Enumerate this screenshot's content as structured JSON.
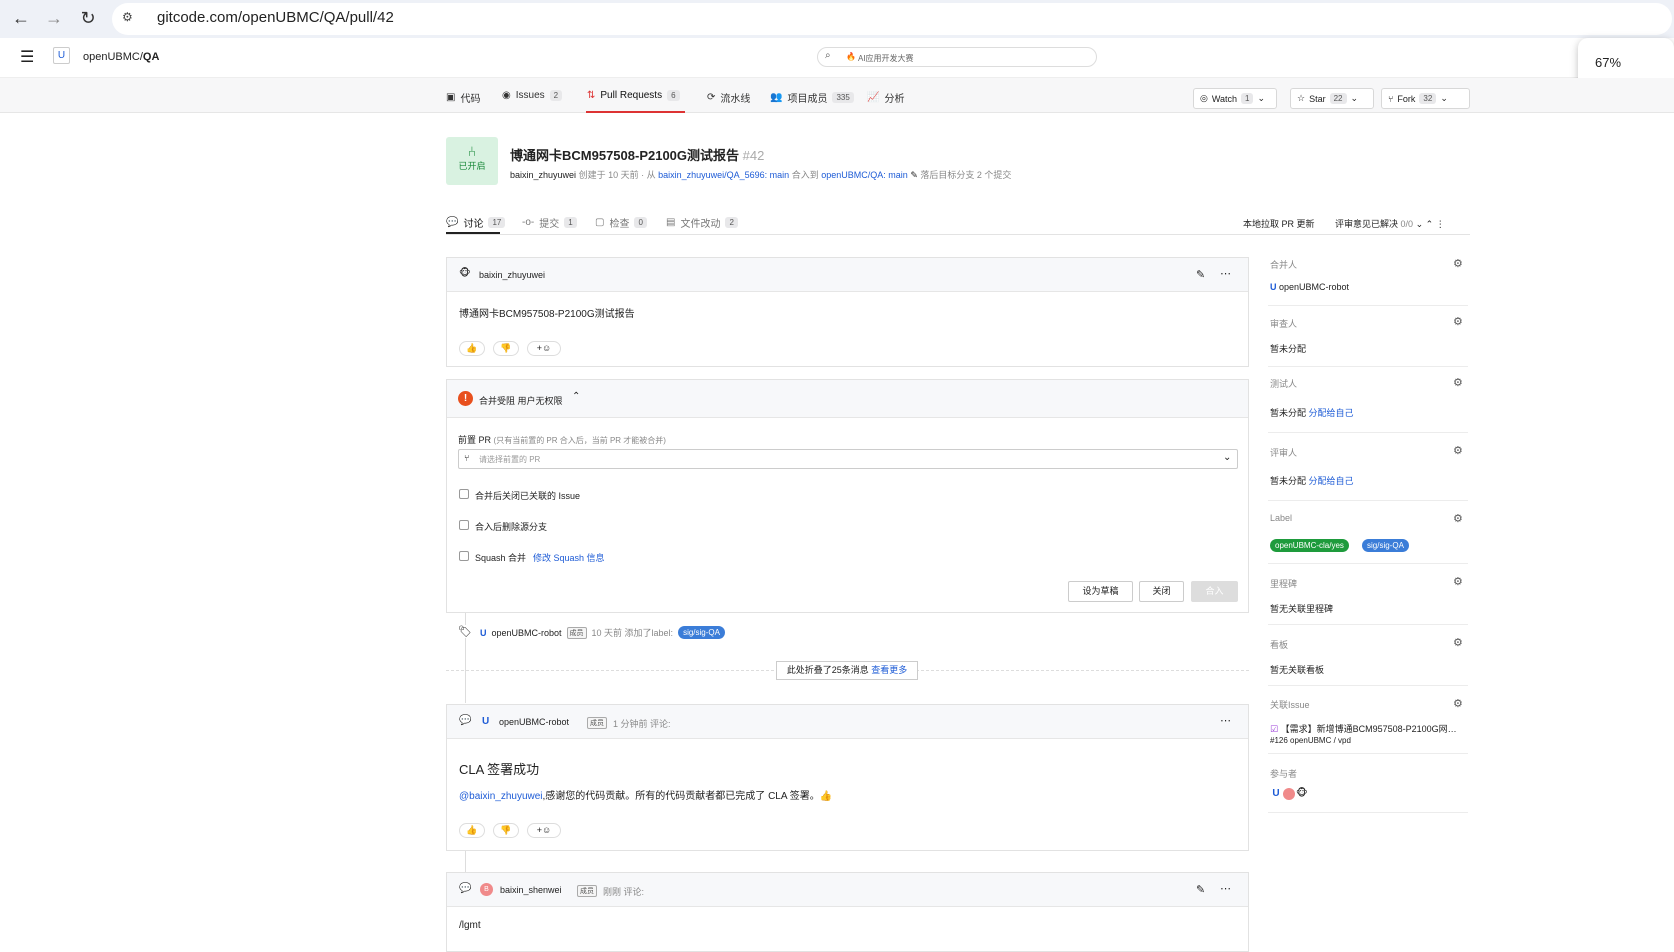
{
  "browser": {
    "url": "gitcode.com/openUBMC/QA/pull/42",
    "zoom": "67%"
  },
  "header": {
    "repo_name": "openUBMC/",
    "repo_bold": "QA",
    "search_placeholder": "AI应用开发大赛"
  },
  "repo_nav": {
    "tabs": [
      {
        "label": "代码",
        "count": ""
      },
      {
        "label": "Issues",
        "count": "2"
      },
      {
        "label": "Pull Requests",
        "count": "6"
      },
      {
        "label": "流水线",
        "count": ""
      },
      {
        "label": "项目成员",
        "count": "335"
      },
      {
        "label": "分析",
        "count": ""
      }
    ],
    "watch": {
      "label": "Watch",
      "count": "1"
    },
    "star": {
      "label": "Star",
      "count": "22"
    },
    "fork": {
      "label": "Fork",
      "count": "32"
    }
  },
  "pr": {
    "status": "已开启",
    "title": "博通网卡BCM957508-P2100G测试报告",
    "number": "#42",
    "author": "baixin_zhuyuwei",
    "created": "创建于 10 天前",
    "from_word": "· 从",
    "source_branch": "baixin_zhuyuwei/QA_5696: main",
    "merge_into": "合入到",
    "target_branch": "openUBMC/QA: main",
    "behind": "落后目标分支 2 个提交"
  },
  "pr_tabs": [
    {
      "label": "讨论",
      "count": "17"
    },
    {
      "label": "提交",
      "count": "1"
    },
    {
      "label": "检查",
      "count": "0"
    },
    {
      "label": "文件改动",
      "count": "2"
    }
  ],
  "pr_tools": {
    "fetch": "本地拉取 PR 更新",
    "resolved": "评审意见已解决",
    "resolved_count": "0/0"
  },
  "description": {
    "author": "baixin_zhuyuwei",
    "body": "博通网卡BCM957508-P2100G测试报告",
    "reaction_up": "👍",
    "reaction_down": "👎",
    "reaction_add": "+☺"
  },
  "merge_box": {
    "status": "合并受阻 用户无权限",
    "pre_pr_label": "前置 PR",
    "pre_pr_hint": "(只有当前置的 PR 合入后，当前 PR 才能被合并)",
    "pre_pr_placeholder": "请选择前置的 PR",
    "opt_close_issue": "合并后关闭已关联的 Issue",
    "opt_delete_branch": "合入后删除源分支",
    "opt_squash": "Squash 合并",
    "squash_link": "修改 Squash 信息",
    "btn_draft": "设为草稿",
    "btn_close": "关闭",
    "btn_merge": "合入"
  },
  "timeline": {
    "label_event": {
      "user": "openUBMC-robot",
      "role": "成员",
      "text": "10 天前 添加了label:",
      "label": "sig/sig-QA"
    },
    "folded": {
      "text": "此处折叠了25条消息",
      "link": "查看更多"
    },
    "comment1": {
      "user": "openUBMC-robot",
      "role": "成员",
      "time": "1 分钟前 评论:",
      "heading": "CLA 签署成功",
      "mention": "@baixin_zhuyuwei",
      "body": ",感谢您的代码贡献。所有的代码贡献者都已完成了 CLA 签署。👍"
    },
    "comment2": {
      "user": "baixin_shenwei",
      "role": "成员",
      "time": "刚刚 评论:",
      "body": "/lgmt"
    }
  },
  "sidebar": {
    "merger": {
      "title": "合并人",
      "value": "openUBMC-robot"
    },
    "reviewer": {
      "title": "审查人",
      "value": "暂未分配"
    },
    "tester": {
      "title": "测试人",
      "value": "暂未分配",
      "link": "分配给自己"
    },
    "commenter": {
      "title": "评审人",
      "value": "暂未分配",
      "link": "分配给自己"
    },
    "label": {
      "title": "Label",
      "labels": [
        "openUBMC-cla/yes",
        "sig/sig-QA"
      ]
    },
    "milestone": {
      "title": "里程碑",
      "value": "暂无关联里程碑"
    },
    "board": {
      "title": "看板",
      "value": "暂无关联看板"
    },
    "issue": {
      "title": "关联Issue",
      "value": "【需求】新增博通BCM957508-P2100G网…",
      "meta": "#126  openUBMC / vpd"
    },
    "participants": {
      "title": "参与者"
    }
  },
  "colors": {
    "accent": "#1d5bd6",
    "open_green": "#1a8a3a",
    "warning": "#e8501e"
  }
}
